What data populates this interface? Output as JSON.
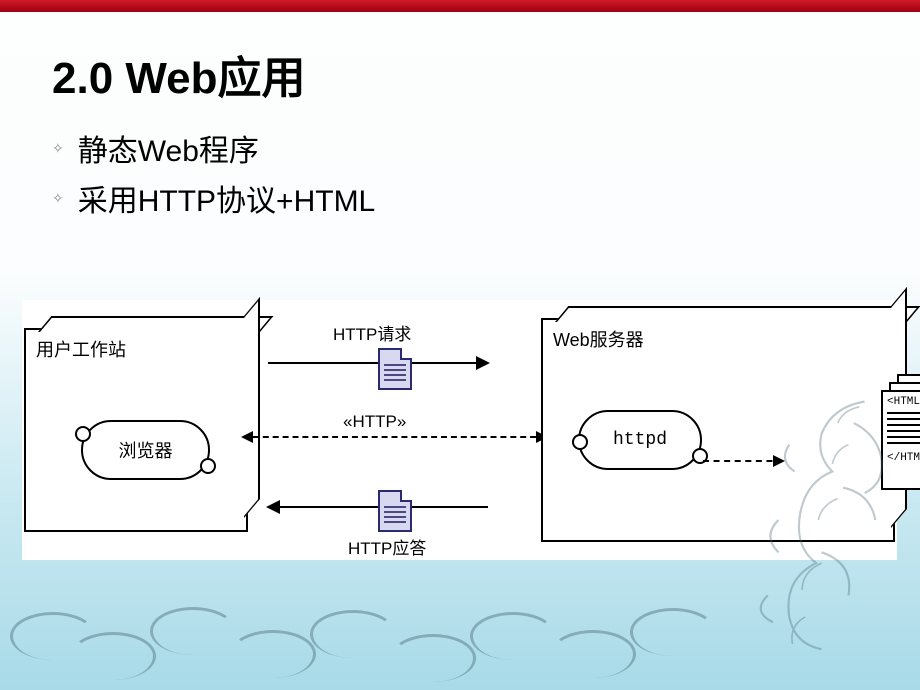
{
  "title": "2.0 Web应用",
  "bullets": [
    "静态Web程序",
    "采用HTTP协议+HTML"
  ],
  "diagram": {
    "left_node": "用户工作站",
    "left_capsule": "浏览器",
    "right_node": "Web服务器",
    "right_capsule": "httpd",
    "request_label": "HTTP请求",
    "response_label": "HTTP应答",
    "protocol_label": "«HTTP»",
    "html_open": "<HTML>",
    "html_close": "</HTML>"
  }
}
